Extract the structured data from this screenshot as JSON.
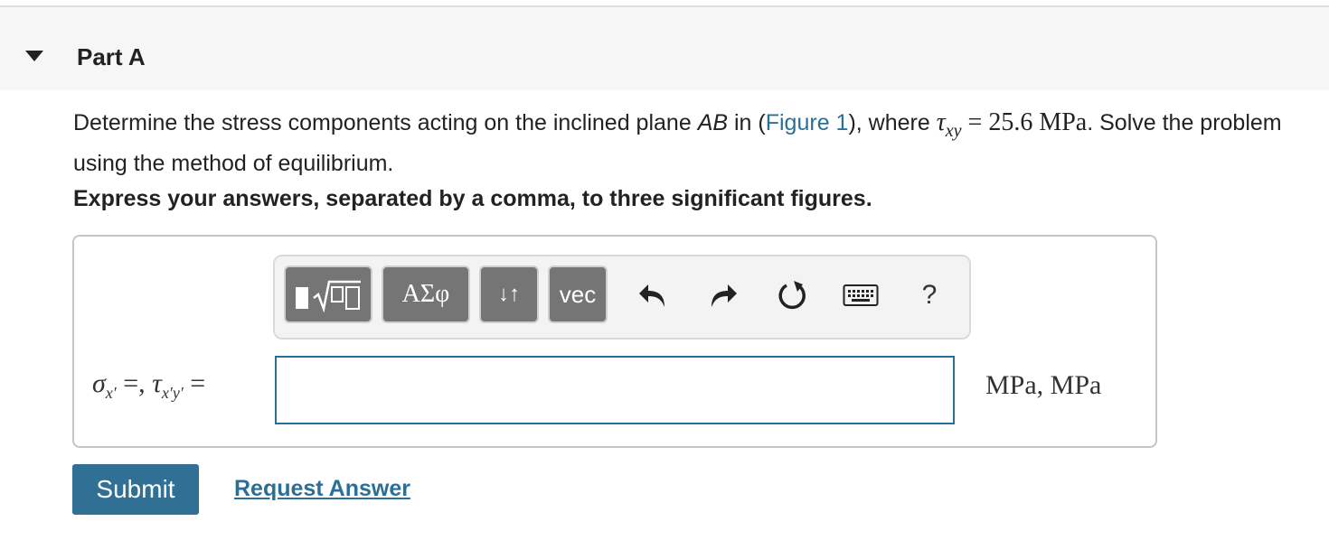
{
  "part": {
    "title": "Part A"
  },
  "problem": {
    "text_before_plane": "Determine the stress components acting on the inclined plane ",
    "plane_name": "AB",
    "text_in": " in (",
    "figure_link": "Figure 1",
    "text_where": "), where ",
    "tau_symbol": "τ",
    "tau_subscript": "xy",
    "equals": "=",
    "tau_value": "25.6",
    "tau_unit": "MPa",
    "text_after": ". Solve the problem using the method of equilibrium."
  },
  "instruction": "Express your answers, separated by a comma, to three significant figures.",
  "toolbar": {
    "templates_label": "▮√▢",
    "greek_label": "ΑΣφ",
    "arrows_label": "↓↑",
    "vec_label": "vec",
    "help_label": "?"
  },
  "answer": {
    "sigma_symbol": "σ",
    "sigma_subscript": "x′",
    "eq_comma": " =, ",
    "tau_symbol": "τ",
    "tau_subscript": "x′y′",
    "eq": " =",
    "input_value": "",
    "units": "MPa, MPa"
  },
  "actions": {
    "submit_label": "Submit",
    "request_label": "Request Answer"
  },
  "colors": {
    "accent": "#2a6f97",
    "button": "#2f7094",
    "toolbar_button": "#757575"
  }
}
